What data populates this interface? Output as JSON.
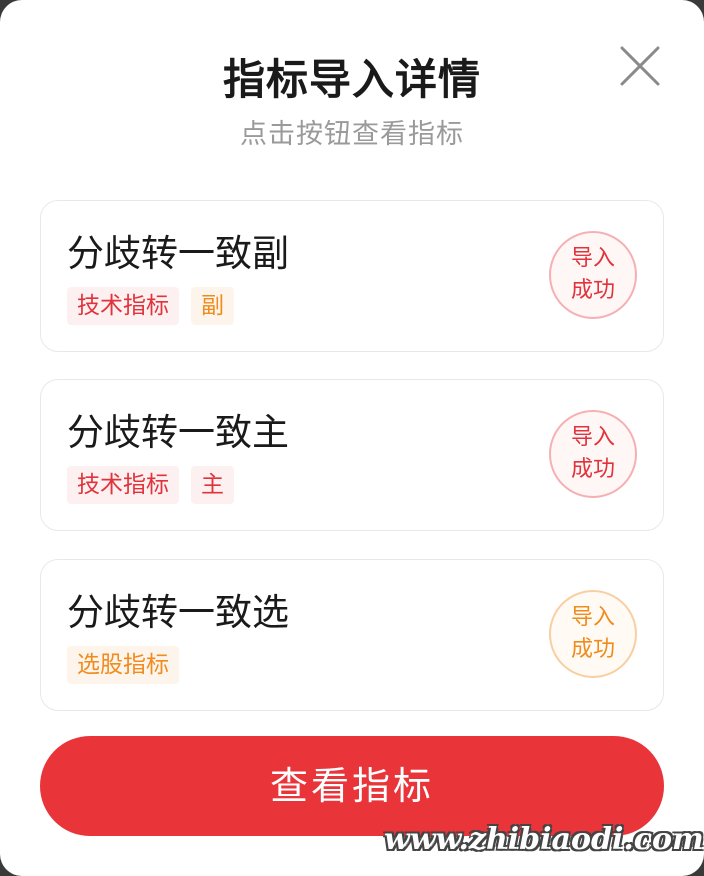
{
  "dialog": {
    "title": "指标导入详情",
    "subtitle": "点击按钮查看指标",
    "close_icon": "close-icon"
  },
  "items": [
    {
      "title": "分歧转一致副",
      "tags": [
        {
          "label": "技术指标",
          "color": "#e0333c"
        },
        {
          "label": "副",
          "color": "#f08b1e"
        }
      ],
      "status_line1": "导入",
      "status_line2": "成功",
      "status_color": "#e0333c"
    },
    {
      "title": "分歧转一致主",
      "tags": [
        {
          "label": "技术指标",
          "color": "#e0333c"
        },
        {
          "label": "主",
          "color": "#e0333c"
        }
      ],
      "status_line1": "导入",
      "status_line2": "成功",
      "status_color": "#e0333c"
    },
    {
      "title": "分歧转一致选",
      "tags": [
        {
          "label": "选股指标",
          "color": "#f08b1e"
        }
      ],
      "status_line1": "导入",
      "status_line2": "成功",
      "status_color": "#f08b1e"
    }
  ],
  "action": {
    "button_label": "查看指标",
    "button_color": "#e9343a"
  },
  "watermark": "www.zhibiaodi.com"
}
